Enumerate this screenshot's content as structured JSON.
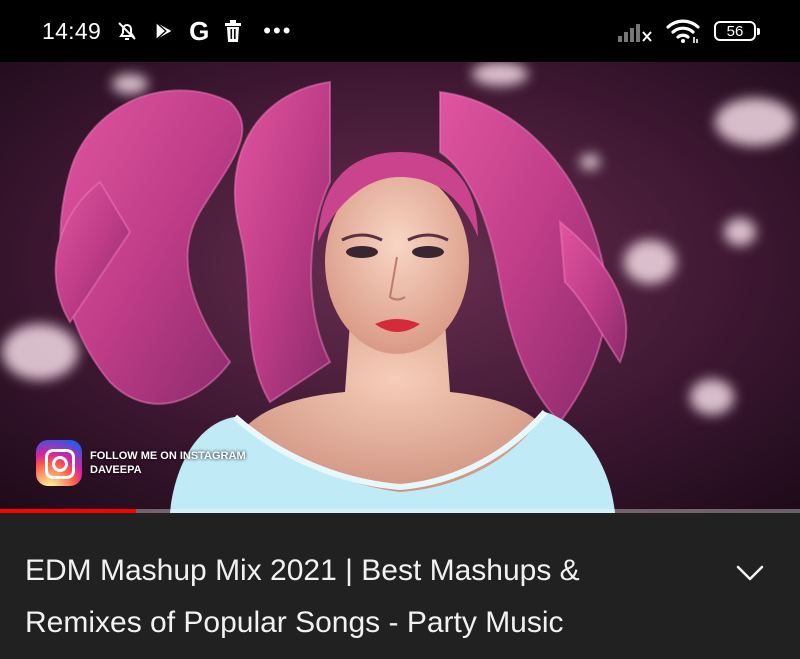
{
  "status_bar": {
    "time": "14:49",
    "battery_level": "56",
    "left_icons": [
      "notifications-muted-icon",
      "play-store-icon",
      "google-icon",
      "trash-icon",
      "more-dots-icon"
    ],
    "right_icons": [
      "signal-no-service-icon",
      "wifi-icon",
      "battery-icon"
    ],
    "google_letter": "G",
    "dots": "•••"
  },
  "video": {
    "overlay": {
      "line1": "FOLLOW ME ON INSTAGRAM",
      "line2": "DAVEEPA"
    },
    "progress": 0.17,
    "progress_color": "#ff0000"
  },
  "title": {
    "text": "EDM Mashup Mix 2021 | Best Mashups & Remixes of Popular Songs - Party Music",
    "expand_icon": "chevron-down-icon"
  },
  "colors": {
    "status_bar_bg": "#000000",
    "page_bg": "#212121",
    "title_text": "#f1f1f1"
  }
}
